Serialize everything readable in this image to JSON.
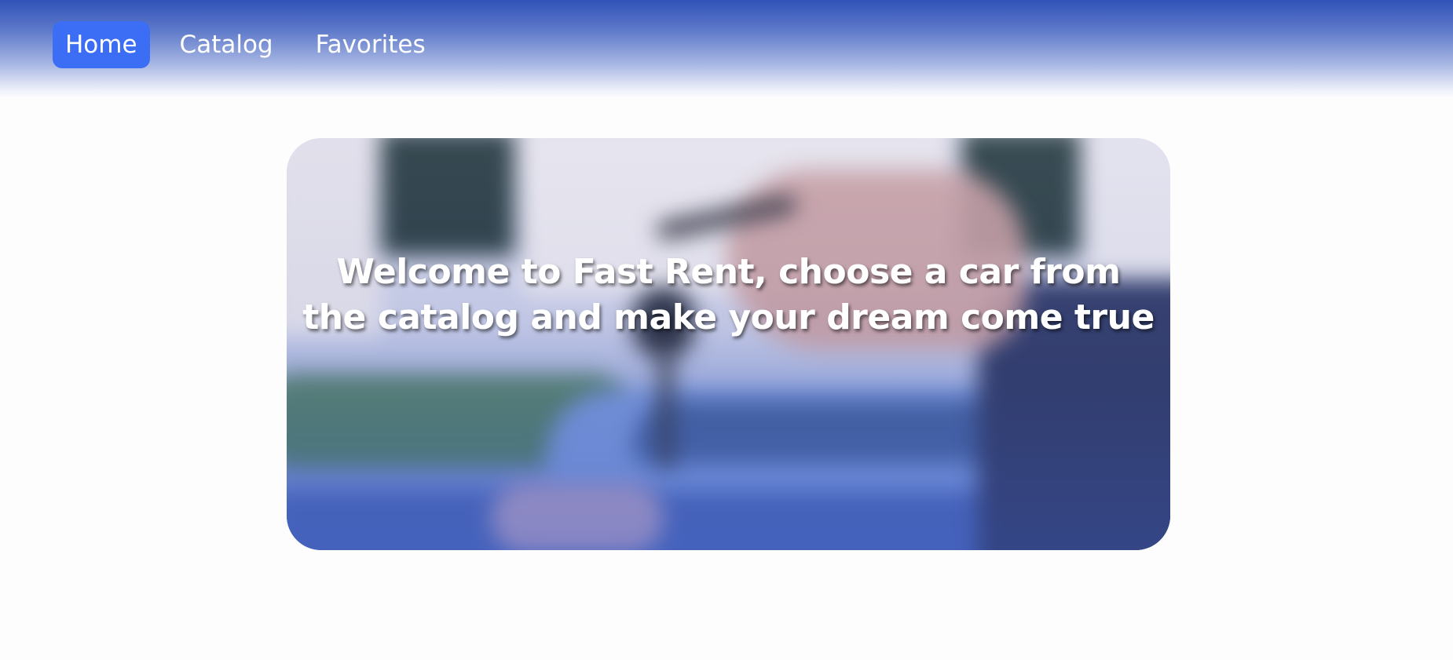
{
  "nav": {
    "items": [
      {
        "label": "Home",
        "active": true
      },
      {
        "label": "Catalog",
        "active": false
      },
      {
        "label": "Favorites",
        "active": false
      }
    ],
    "accent_color": "#3b6df5"
  },
  "hero": {
    "headline": "Welcome to Fast Rent, choose a car from the catalog and make your dream come true",
    "image": "blurred-hand-holding-car-keys-in-front-of-car"
  }
}
